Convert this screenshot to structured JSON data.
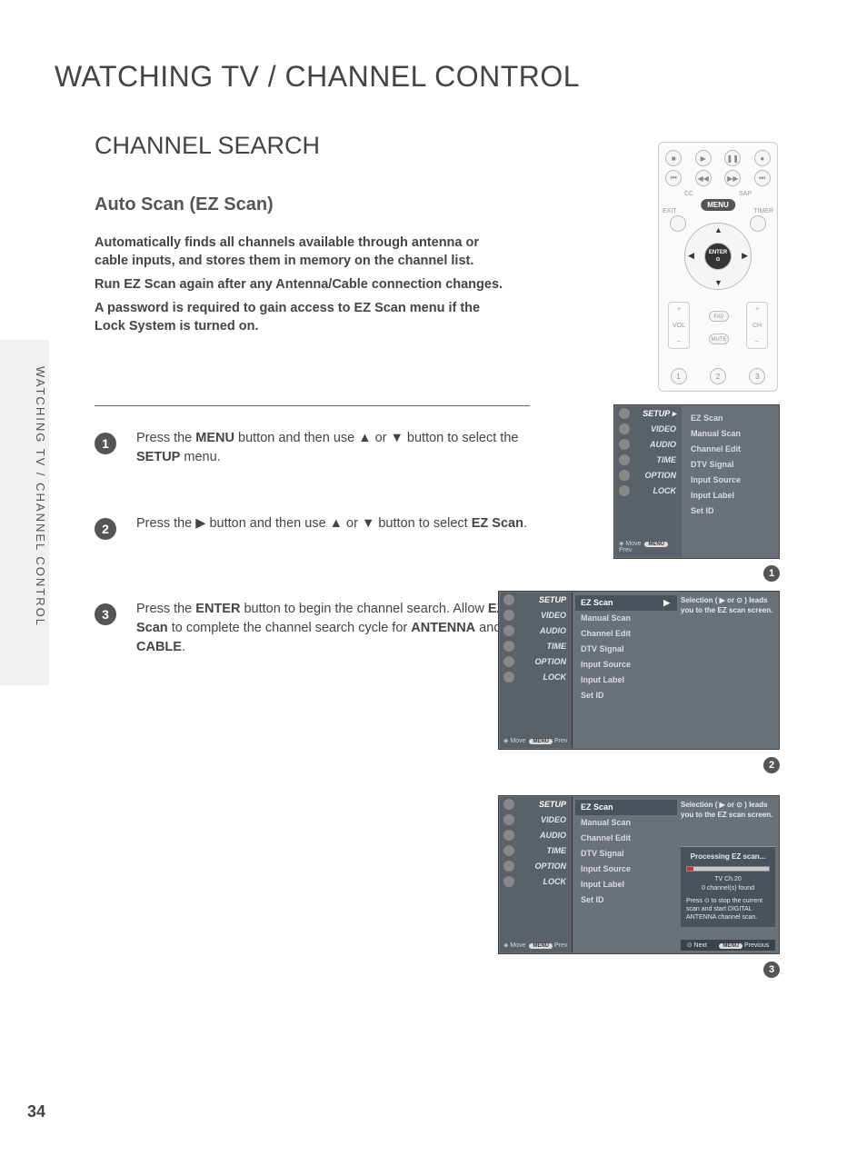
{
  "page_title": "WATCHING TV / CHANNEL CONTROL",
  "section_title": "CHANNEL SEARCH",
  "subsection_title": "Auto Scan (EZ Scan)",
  "intro": {
    "p1": "Automatically finds all channels available through antenna or cable inputs, and stores them in memory on the channel list.",
    "p2": "Run EZ Scan again after any Antenna/Cable connection changes.",
    "p3": "A password is required to gain access to EZ Scan menu if the Lock System is turned on."
  },
  "side_tab": "WATCHING TV / CHANNEL CONTROL",
  "steps": {
    "s1": {
      "num": "1",
      "pre": "Press the ",
      "b1": "MENU",
      "mid": " button and then use ▲ or ▼ button to select the ",
      "b2": "SETUP",
      "post": " menu."
    },
    "s2": {
      "num": "2",
      "pre": "Press the ▶ button and then use ▲ or ▼ button to select ",
      "b1": "EZ Scan",
      "post": "."
    },
    "s3": {
      "num": "3",
      "pre": "Press the ",
      "b1": "ENTER",
      "mid": " button to begin the channel search. Allow ",
      "b2": "EZ Scan",
      "mid2": " to complete the channel search cycle for ",
      "b3": "ANTENNA",
      "mid3": " and ",
      "b4": "CABLE",
      "post": "."
    }
  },
  "remote": {
    "cc": "CC",
    "sap": "SAP",
    "exit": "EXIT",
    "timer": "TIMER",
    "menu": "MENU",
    "enter": "ENTER",
    "enter_sym": "⊙",
    "vol": "VOL",
    "ch": "CH",
    "fav": "FAV",
    "mute": "MUTE",
    "n1": "1",
    "n2": "2",
    "n3": "3",
    "plus": "+",
    "minus": "–"
  },
  "menu": {
    "side_items": [
      "SETUP",
      "VIDEO",
      "AUDIO",
      "TIME",
      "OPTION",
      "LOCK"
    ],
    "list_items": [
      "EZ Scan",
      "Manual Scan",
      "Channel Edit",
      "DTV Signal",
      "Input Source",
      "Input Label",
      "Set ID"
    ],
    "footer_move": "Move",
    "footer_prev": "Prev",
    "tip": "Selection ( ▶ or ⊙ ) leads you to the EZ scan screen.",
    "scan": {
      "title": "Processing EZ scan...",
      "ch": "TV Ch.20",
      "found": "0 channel(s) found",
      "msg": "Press ⊙ to stop the current scan and start DIGITAL ANTENNA channel scan.",
      "next": "⊙ Next",
      "menu_lbl": "MENU",
      "previous": "Previous"
    }
  },
  "page_number": "34"
}
